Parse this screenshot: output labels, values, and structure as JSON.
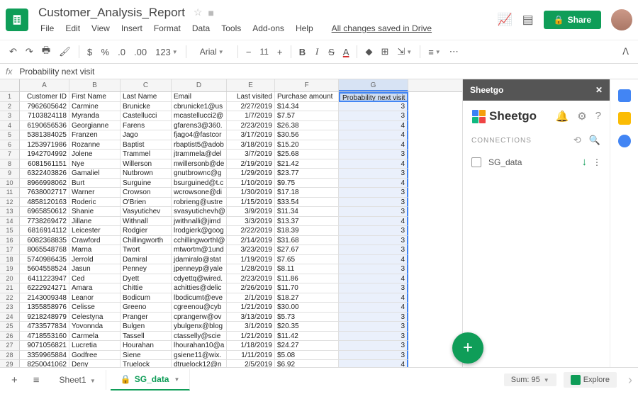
{
  "doc": {
    "title": "Customer_Analysis_Report",
    "saved": "All changes saved in Drive"
  },
  "menus": [
    "File",
    "Edit",
    "View",
    "Insert",
    "Format",
    "Data",
    "Tools",
    "Add-ons",
    "Help"
  ],
  "share": "Share",
  "toolbar": {
    "font": "Arial",
    "size": "11",
    "fmt": "123"
  },
  "formula": {
    "fx": "fx",
    "value": "Probability next visit"
  },
  "columns": [
    "A",
    "B",
    "C",
    "D",
    "E",
    "F",
    "G"
  ],
  "headers": [
    "Customer ID",
    "First Name",
    "Last Name",
    "Email",
    "Last visited",
    "Purchase amount",
    "Probability next visit"
  ],
  "rows": [
    [
      "7962605642",
      "Carmine",
      "Brunicke",
      "cbrunicke1@us",
      "2/27/2019",
      "$14.34",
      "3"
    ],
    [
      "7103824118",
      "Myranda",
      "Castellucci",
      "mcastellucci2@",
      "1/7/2019",
      "$7.57",
      "3"
    ],
    [
      "6190656536",
      "Georgianne",
      "Farens",
      "gfarens3@360.",
      "2/23/2019",
      "$26.38",
      "4"
    ],
    [
      "5381384025",
      "Franzen",
      "Jago",
      "fjago4@fastcor",
      "3/17/2019",
      "$30.56",
      "4"
    ],
    [
      "1253971986",
      "Rozanne",
      "Baptist",
      "rbaptist5@adob",
      "3/18/2019",
      "$15.20",
      "4"
    ],
    [
      "1942704992",
      "Jolene",
      "Trammel",
      "jtrammela@del",
      "3/7/2019",
      "$25.68",
      "3"
    ],
    [
      "6081561151",
      "Nye",
      "Willerson",
      "nwillersonb@de",
      "2/19/2019",
      "$21.42",
      "4"
    ],
    [
      "6322403826",
      "Gamaliel",
      "Nutbrown",
      "gnutbrownc@g",
      "1/29/2019",
      "$23.77",
      "3"
    ],
    [
      "8966998062",
      "Burt",
      "Surguine",
      "bsurguined@t.c",
      "1/10/2019",
      "$9.75",
      "4"
    ],
    [
      "7638002717",
      "Warner",
      "Crowson",
      "wcrowsone@di",
      "1/30/2019",
      "$17.18",
      "3"
    ],
    [
      "4858120163",
      "Roderic",
      "O'Brien",
      "robrieng@ustre",
      "1/15/2019",
      "$33.54",
      "3"
    ],
    [
      "6965850612",
      "Shanie",
      "Vasyutichev",
      "svasyutichevh@",
      "3/9/2019",
      "$11.34",
      "3"
    ],
    [
      "7738269472",
      "Jillane",
      "Withnall",
      "jwithnalli@jimd",
      "3/3/2019",
      "$13.37",
      "4"
    ],
    [
      "6816914112",
      "Leicester",
      "Rodgier",
      "lrodgierk@goog",
      "2/22/2019",
      "$18.39",
      "3"
    ],
    [
      "6082368835",
      "Crawford",
      "Chillingworth",
      "cchillingworthl@",
      "2/14/2019",
      "$31.68",
      "3"
    ],
    [
      "8065548768",
      "Marna",
      "Twort",
      "mtwortm@1und",
      "3/23/2019",
      "$27.67",
      "3"
    ],
    [
      "5740986435",
      "Jerrold",
      "Damiral",
      "jdamiralo@stat",
      "1/19/2019",
      "$7.65",
      "4"
    ],
    [
      "5604558524",
      "Jasun",
      "Penney",
      "jpenneyp@yale",
      "1/28/2019",
      "$8.11",
      "3"
    ],
    [
      "6411223947",
      "Ced",
      "Dyett",
      "cdyettq@wired.",
      "2/23/2019",
      "$11.86",
      "4"
    ],
    [
      "6222924271",
      "Amara",
      "Chittie",
      "achitties@delic",
      "2/26/2019",
      "$11.70",
      "3"
    ],
    [
      "2143009348",
      "Leanor",
      "Bodicum",
      "lbodicumt@eve",
      "2/1/2019",
      "$18.27",
      "4"
    ],
    [
      "1355858976",
      "Celisse",
      "Greeno",
      "cgreenou@cyb",
      "1/21/2019",
      "$30.00",
      "4"
    ],
    [
      "9218248979",
      "Celestyna",
      "Pranger",
      "cprangerw@ov",
      "3/13/2019",
      "$5.73",
      "3"
    ],
    [
      "4733577834",
      "Yovonnda",
      "Bulgen",
      "ybulgenx@blog",
      "3/1/2019",
      "$20.35",
      "3"
    ],
    [
      "4718553160",
      "Carmela",
      "Tassell",
      "ctasselly@scie",
      "1/21/2019",
      "$11.42",
      "3"
    ],
    [
      "9071056821",
      "Lucretia",
      "Hourahan",
      "lhourahan10@a",
      "1/18/2019",
      "$24.27",
      "3"
    ],
    [
      "3359965884",
      "Godfree",
      "Siene",
      "gsiene11@wix.",
      "1/11/2019",
      "$5.08",
      "3"
    ],
    [
      "8250041062",
      "Deny",
      "Truelock",
      "dtruelock12@n",
      "2/5/2019",
      "$6.92",
      "4"
    ]
  ],
  "sheetgo": {
    "title": "Sheetgo",
    "brand": "Sheetgo",
    "section": "CONNECTIONS",
    "item": "SG_data"
  },
  "tabs": {
    "t1": "Sheet1",
    "t2": "SG_data",
    "sum": "Sum: 95",
    "explore": "Explore"
  }
}
